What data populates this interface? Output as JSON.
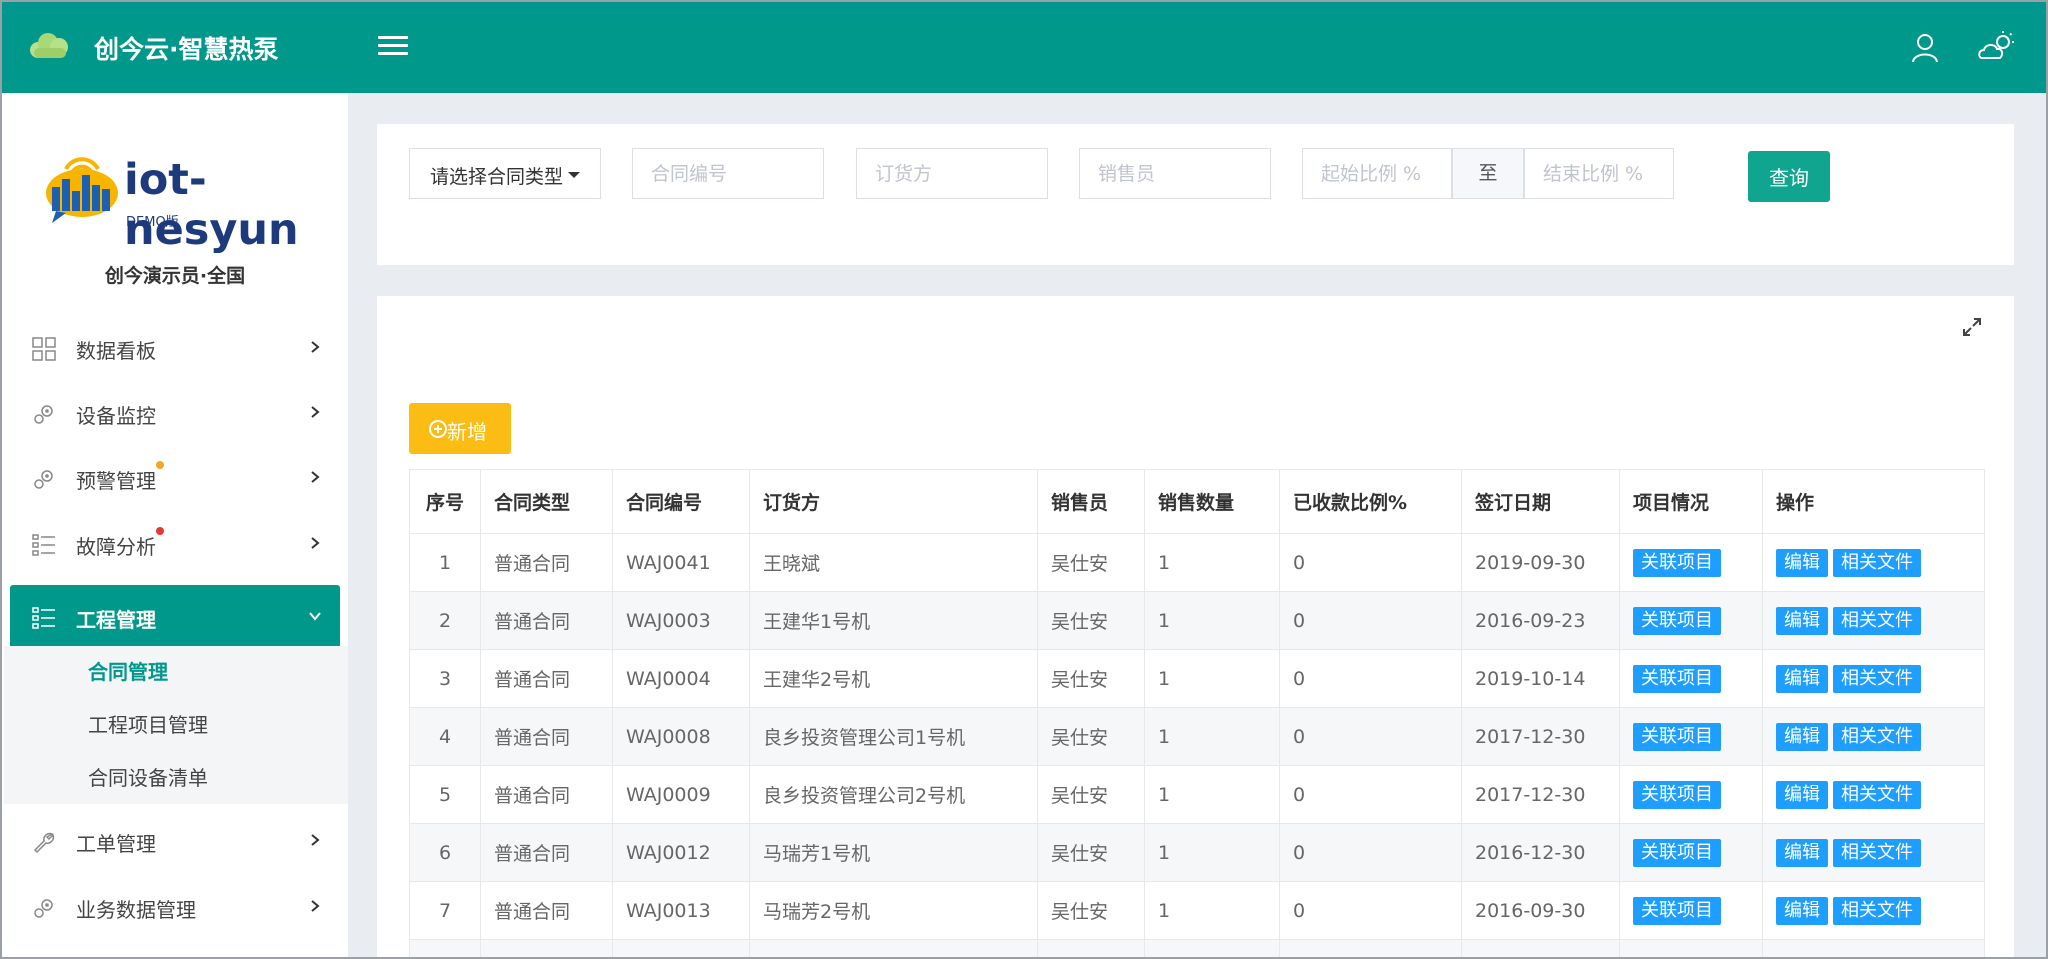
{
  "header": {
    "title": "创今云·智慧热泵",
    "logo_icon": "cloud-logo-icon",
    "menu_icon": "hamburger-menu-icon",
    "user_icon": "user-icon",
    "weather_icon": "weather-icon",
    "accent_color": "#00988a"
  },
  "sidebar": {
    "logo_text": "iot-nesyun",
    "logo_sub": "DEMO版",
    "user_name": "创今演示员·全国",
    "items": [
      {
        "label": "数据看板",
        "icon": "grid-icon"
      },
      {
        "label": "设备监控",
        "icon": "gears-icon"
      },
      {
        "label": "预警管理",
        "icon": "gears-icon",
        "dot": "#f5a623"
      },
      {
        "label": "故障分析",
        "icon": "list-icon",
        "dot": "#e53935"
      },
      {
        "label": "工程管理",
        "icon": "list-icon",
        "active": true
      },
      {
        "label": "工单管理",
        "icon": "wrench-icon"
      },
      {
        "label": "业务数据管理",
        "icon": "gears-icon"
      }
    ],
    "sub_items": [
      {
        "label": "合同管理",
        "current": true
      },
      {
        "label": "工程项目管理"
      },
      {
        "label": "合同设备清单"
      }
    ]
  },
  "search": {
    "type_select": "请选择合同类型",
    "contract_no_placeholder": "合同编号",
    "buyer_placeholder": "订货方",
    "seller_placeholder": "销售员",
    "start_ratio_placeholder": "起始比例 %",
    "to_label": "至",
    "end_ratio_placeholder": "结束比例 %",
    "query_label": "查询"
  },
  "main": {
    "add_label": "新增",
    "expand_icon": "expand-icon",
    "columns": [
      "序号",
      "合同类型",
      "合同编号",
      "订货方",
      "销售员",
      "销售数量",
      "已收款比例%",
      "签订日期",
      "项目情况",
      "操作"
    ],
    "link_project_label": "关联项目",
    "edit_label": "编辑",
    "files_label": "相关文件",
    "rows": [
      {
        "no": "1",
        "type": "普通合同",
        "code": "WAJ0041",
        "buyer": "王晓斌",
        "seller": "吴仕安",
        "qty": "1",
        "ratio": "0",
        "date": "2019-09-30"
      },
      {
        "no": "2",
        "type": "普通合同",
        "code": "WAJ0003",
        "buyer": "王建华1号机",
        "seller": "吴仕安",
        "qty": "1",
        "ratio": "0",
        "date": "2016-09-23"
      },
      {
        "no": "3",
        "type": "普通合同",
        "code": "WAJ0004",
        "buyer": "王建华2号机",
        "seller": "吴仕安",
        "qty": "1",
        "ratio": "0",
        "date": "2019-10-14"
      },
      {
        "no": "4",
        "type": "普通合同",
        "code": "WAJ0008",
        "buyer": "良乡投资管理公司1号机",
        "seller": "吴仕安",
        "qty": "1",
        "ratio": "0",
        "date": "2017-12-30"
      },
      {
        "no": "5",
        "type": "普通合同",
        "code": "WAJ0009",
        "buyer": "良乡投资管理公司2号机",
        "seller": "吴仕安",
        "qty": "1",
        "ratio": "0",
        "date": "2017-12-30"
      },
      {
        "no": "6",
        "type": "普通合同",
        "code": "WAJ0012",
        "buyer": "马瑞芳1号机",
        "seller": "吴仕安",
        "qty": "1",
        "ratio": "0",
        "date": "2016-12-30"
      },
      {
        "no": "7",
        "type": "普通合同",
        "code": "WAJ0013",
        "buyer": "马瑞芳2号机",
        "seller": "吴仕安",
        "qty": "1",
        "ratio": "0",
        "date": "2016-09-30"
      }
    ]
  }
}
